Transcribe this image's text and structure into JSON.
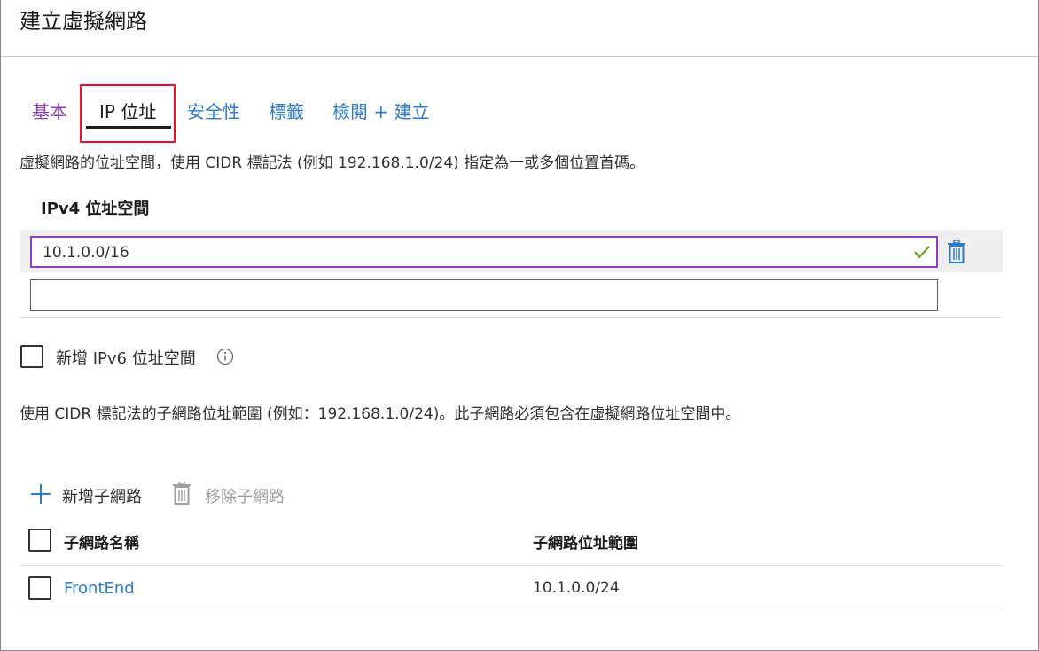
{
  "page": {
    "title": "建立虛擬網路"
  },
  "tabs": [
    {
      "label": "基本"
    },
    {
      "label": "IP 位址",
      "selected": true
    },
    {
      "label": "安全性"
    },
    {
      "label": "標籤"
    },
    {
      "label": "檢閱 + 建立"
    }
  ],
  "address_space": {
    "description": "虛擬網路的位址空間，使用 CIDR 標記法 (例如 192.168.1.0/24) 指定為一或多個位置首碼。",
    "label": "IPv4 位址空間",
    "entries": [
      {
        "value": "10.1.0.0/16",
        "valid": true
      },
      {
        "value": ""
      }
    ]
  },
  "ipv6": {
    "label": "新增 IPv6 位址空間",
    "checked": false,
    "icon": "info-icon"
  },
  "subnets": {
    "description": "使用 CIDR 標記法的子網路位址範圍 (例如：192.168.1.0/24)。此子網路必須包含在虛擬網路位址空間中。",
    "add_label": "新增子網路",
    "remove_label": "移除子網路",
    "columns": [
      "子網路名稱",
      "子網路位址範圍"
    ],
    "rows": [
      {
        "name": "FrontEnd",
        "range": "10.1.0.0/24"
      }
    ]
  },
  "colors": {
    "accent_purple": "#8a3fb3",
    "link_blue": "#2b7bc7",
    "highlight_red": "#e81123",
    "valid_green": "#57a300"
  }
}
